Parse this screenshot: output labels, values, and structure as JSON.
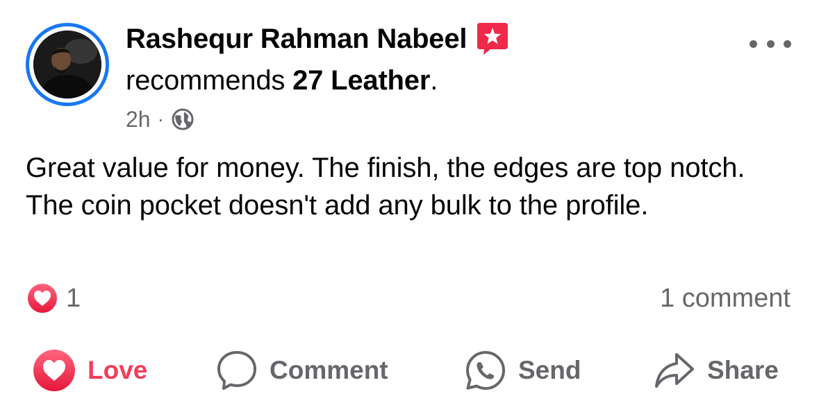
{
  "post": {
    "author": {
      "name": "Rashequr Rahman Nabeel",
      "avatar_icon": "profile-photo"
    },
    "recommendation": {
      "prefix": "recommends ",
      "page_name": "27 Leather",
      "suffix": ".",
      "badge_icon": "recommendation-star-icon",
      "badge_color": "#F02849"
    },
    "meta": {
      "time": "2h",
      "separator": "·",
      "privacy_icon": "globe-icon"
    },
    "text": "Great value for money. The finish, the edges are top notch. The coin pocket doesn't add any bulk to the profile.",
    "reactions": {
      "icon": "love-reaction-icon",
      "count": "1"
    },
    "comments_label": "1 comment",
    "actions": {
      "love": "Love",
      "comment": "Comment",
      "send": "Send",
      "share": "Share"
    }
  },
  "colors": {
    "accent_blue": "#1877F2",
    "love_red": "#F33E58",
    "secondary_text": "#65676B",
    "primary_text": "#050505"
  }
}
